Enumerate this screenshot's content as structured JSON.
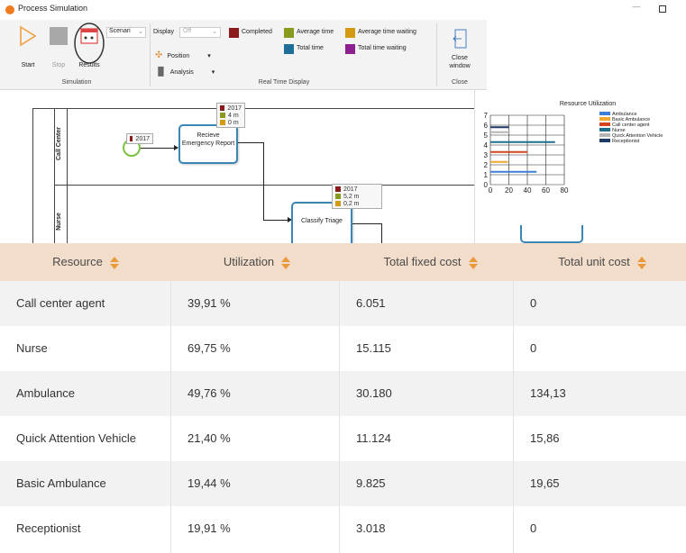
{
  "window": {
    "title": "Process Simulation"
  },
  "ribbon": {
    "simulation": {
      "start": "Start",
      "stop": "Stop",
      "results": "Results",
      "scenario": "Scenari",
      "group_label": "Simulation"
    },
    "realtime": {
      "display_label": "Display",
      "display_value": "Off",
      "position": "Position",
      "analysis": "Analysis",
      "legend": [
        {
          "label": "Completed",
          "color": "#8b1a1a"
        },
        {
          "label": "Average time",
          "color": "#8a9a1e"
        },
        {
          "label": "Average time waiting",
          "color": "#d49a10"
        },
        {
          "label": "Total time",
          "color": "#1f6e9a"
        },
        {
          "label": "Total time waiting",
          "color": "#8e1f8e"
        }
      ],
      "group_label": "Real Time Display"
    },
    "close": {
      "button": "Close window",
      "group_label": "Close"
    }
  },
  "diagram": {
    "lanes": [
      "Call Center",
      "Nurse"
    ],
    "start_event_stats": [
      "2017"
    ],
    "task1": {
      "label": "Recieve Emergency Report",
      "stats": [
        "2017",
        "4 m",
        "0 m"
      ]
    },
    "task2": {
      "label": "Classify Triage",
      "stats": [
        "2017",
        "5,2 m",
        "0,2 m"
      ]
    }
  },
  "chart_data": {
    "type": "bar",
    "orientation": "horizontal",
    "title": "Resource Utilization",
    "xlim": [
      0,
      80
    ],
    "ylim": [
      0,
      7
    ],
    "x_ticks": [
      "0",
      "20",
      "40",
      "60",
      "80"
    ],
    "y_ticks": [
      "0",
      "1",
      "2",
      "3",
      "4",
      "5",
      "6",
      "7"
    ],
    "series": [
      {
        "name": "Ambulance",
        "color": "#3b7fd9",
        "values": [
          50
        ]
      },
      {
        "name": "Basic Ambulance",
        "color": "#f0a830",
        "values": [
          19
        ]
      },
      {
        "name": "Call center agent",
        "color": "#d2461f",
        "values": [
          40
        ]
      },
      {
        "name": "Nurse",
        "color": "#1f6e8c",
        "values": [
          70
        ]
      },
      {
        "name": "Quick Attention Vehicle",
        "color": "#b5b5b5",
        "values": [
          21
        ]
      },
      {
        "name": "Receptionist",
        "color": "#1c3a63",
        "values": [
          20
        ]
      }
    ]
  },
  "table": {
    "headers": [
      "Resource",
      "Utilization",
      "Total fixed cost",
      "Total unit cost"
    ],
    "rows": [
      [
        "Call center agent",
        "39,91 %",
        "6.051",
        "0"
      ],
      [
        "Nurse",
        "69,75 %",
        "15.115",
        "0"
      ],
      [
        "Ambulance",
        "49,76 %",
        "30.180",
        "134,13"
      ],
      [
        "Quick Attention Vehicle",
        "21,40 %",
        "11.124",
        "15,86"
      ],
      [
        "Basic Ambulance",
        "19,44 %",
        "9.825",
        "19,65"
      ],
      [
        "Receptionist",
        "19,91 %",
        "3.018",
        "0"
      ]
    ]
  }
}
